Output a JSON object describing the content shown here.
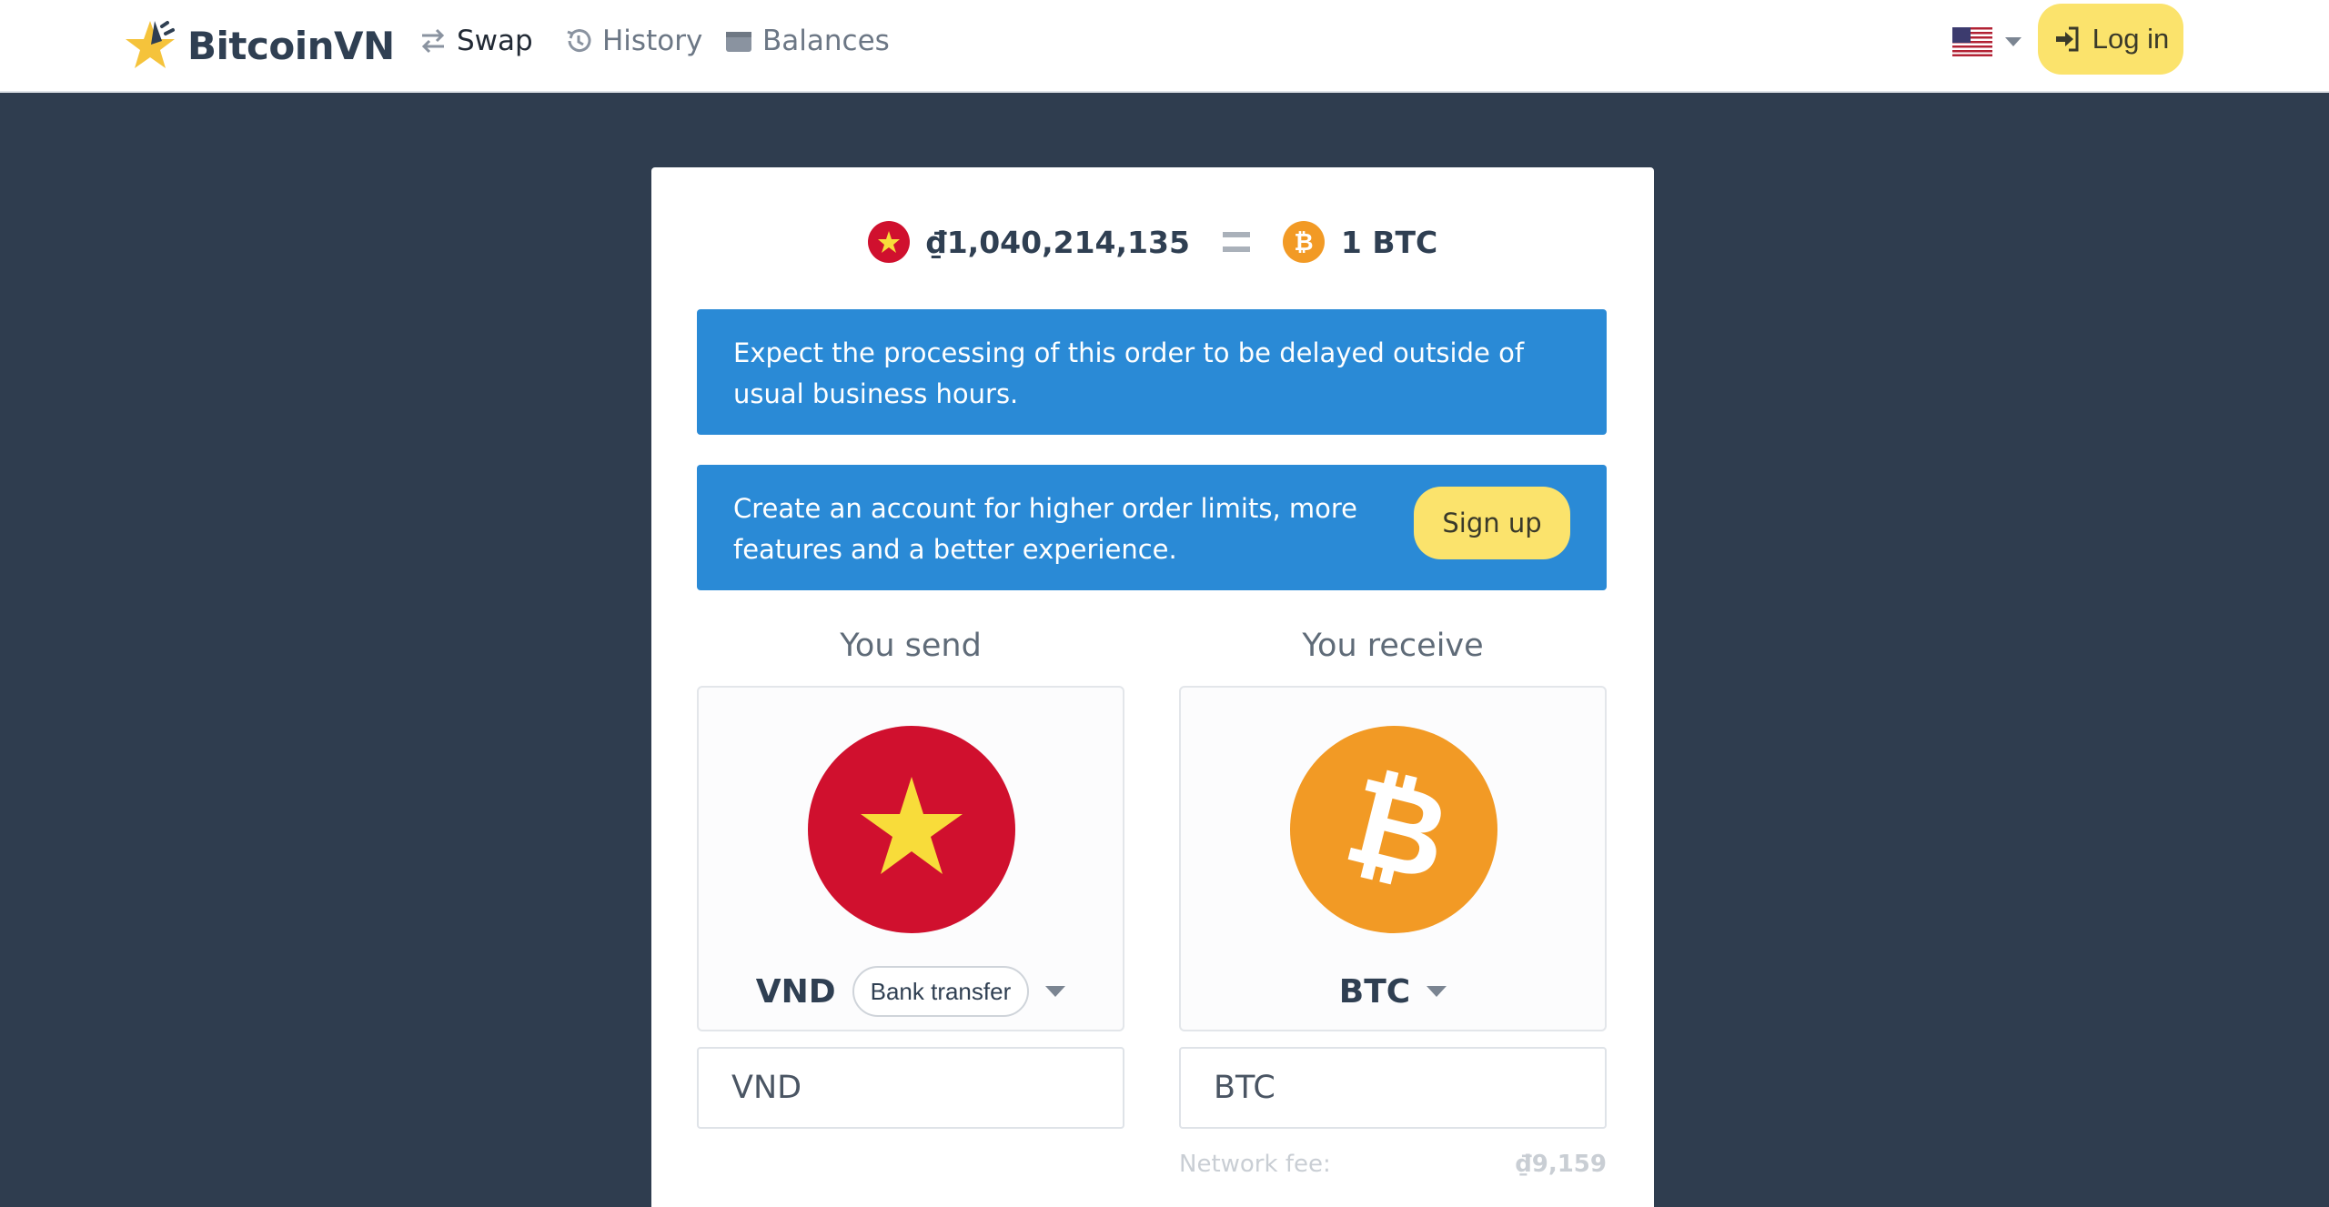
{
  "brand": {
    "name": "BitcoinVN",
    "logo_icon": "star-logo-icon"
  },
  "nav": {
    "swap": "Swap",
    "history": "History",
    "balances": "Balances"
  },
  "header": {
    "language_flag": "us-flag-icon",
    "login_label": "Log in"
  },
  "rate": {
    "from_amount": "₫1,040,214,135",
    "to_amount": "1 BTC"
  },
  "alerts": {
    "delay_message": "Expect the processing of this order to be delayed outside of usual business hours.",
    "signup_message": "Create an account for higher order limits, more features and a better experience.",
    "signup_button": "Sign up"
  },
  "send": {
    "heading": "You send",
    "currency": "VND",
    "method": "Bank transfer",
    "amount_placeholder": "VND"
  },
  "receive": {
    "heading": "You receive",
    "currency": "BTC",
    "amount_placeholder": "BTC",
    "fee_label": "Network fee:",
    "fee_value": "₫9,159"
  },
  "colors": {
    "accent_yellow": "#fbe36c",
    "alert_blue": "#2a8ad6",
    "background": "#2f3d4f",
    "vnd_red": "#d0102e",
    "btc_orange": "#f29a25"
  }
}
